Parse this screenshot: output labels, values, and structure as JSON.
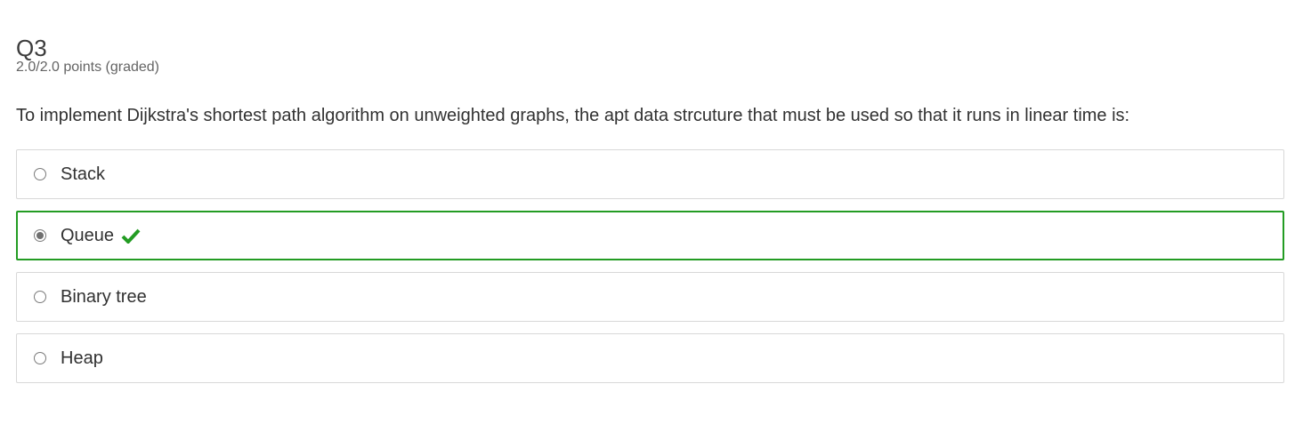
{
  "problem": {
    "title": "Q3",
    "score": "2.0/2.0 points (graded)",
    "question": "To implement Dijkstra's shortest path algorithm on unweighted graphs, the apt data strcuture that must be used so that it runs in linear time is:"
  },
  "options": [
    {
      "label": "Stack",
      "selected": false,
      "correct": false
    },
    {
      "label": "Queue",
      "selected": true,
      "correct": true
    },
    {
      "label": "Binary tree",
      "selected": false,
      "correct": false
    },
    {
      "label": "Heap",
      "selected": false,
      "correct": false
    }
  ],
  "colors": {
    "correct": "#239c23",
    "border": "#d8d8d8",
    "text": "#313131"
  },
  "icons": {
    "correct_indicator": "checkmark-icon"
  }
}
